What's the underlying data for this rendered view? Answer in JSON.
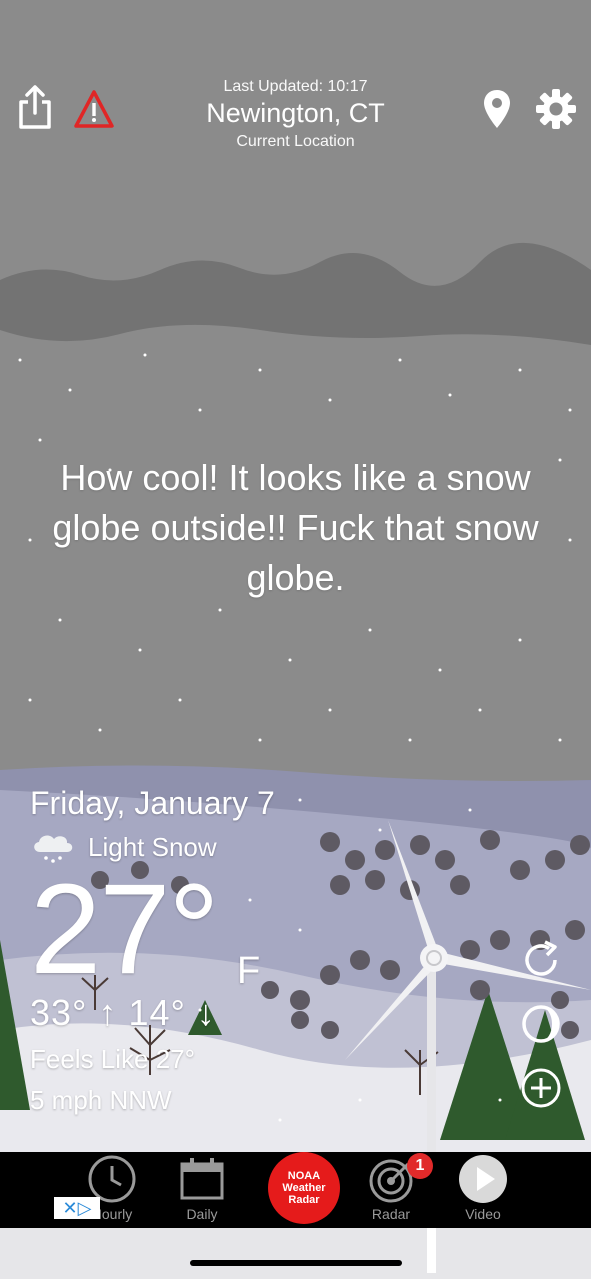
{
  "header": {
    "last_updated": "Last Updated: 10:17",
    "city": "Newington, CT",
    "location_type": "Current Location"
  },
  "message": "How cool! It looks like a snow globe outside!! Fuck that snow globe.",
  "weather": {
    "date": "Friday, January 7",
    "condition": "Light Snow",
    "temperature": "27°",
    "unit": "F",
    "hilo": "33° ↑  14° ↓",
    "feels_like": "Feels Like  27°",
    "wind": "5 mph NNW"
  },
  "tabbar": {
    "hourly": "Hourly",
    "daily": "Daily",
    "noaa": "NOAA Weather Radar",
    "radar": "Radar",
    "radar_badge": "1",
    "video": "Video"
  },
  "ad": {
    "choice": "✕▷"
  },
  "colors": {
    "sky": "#8a8a8a",
    "hills": "#9fa1bb",
    "snow": "#eeeef0",
    "tree": "#2f5a2d",
    "noaa": "#e51b1b"
  }
}
